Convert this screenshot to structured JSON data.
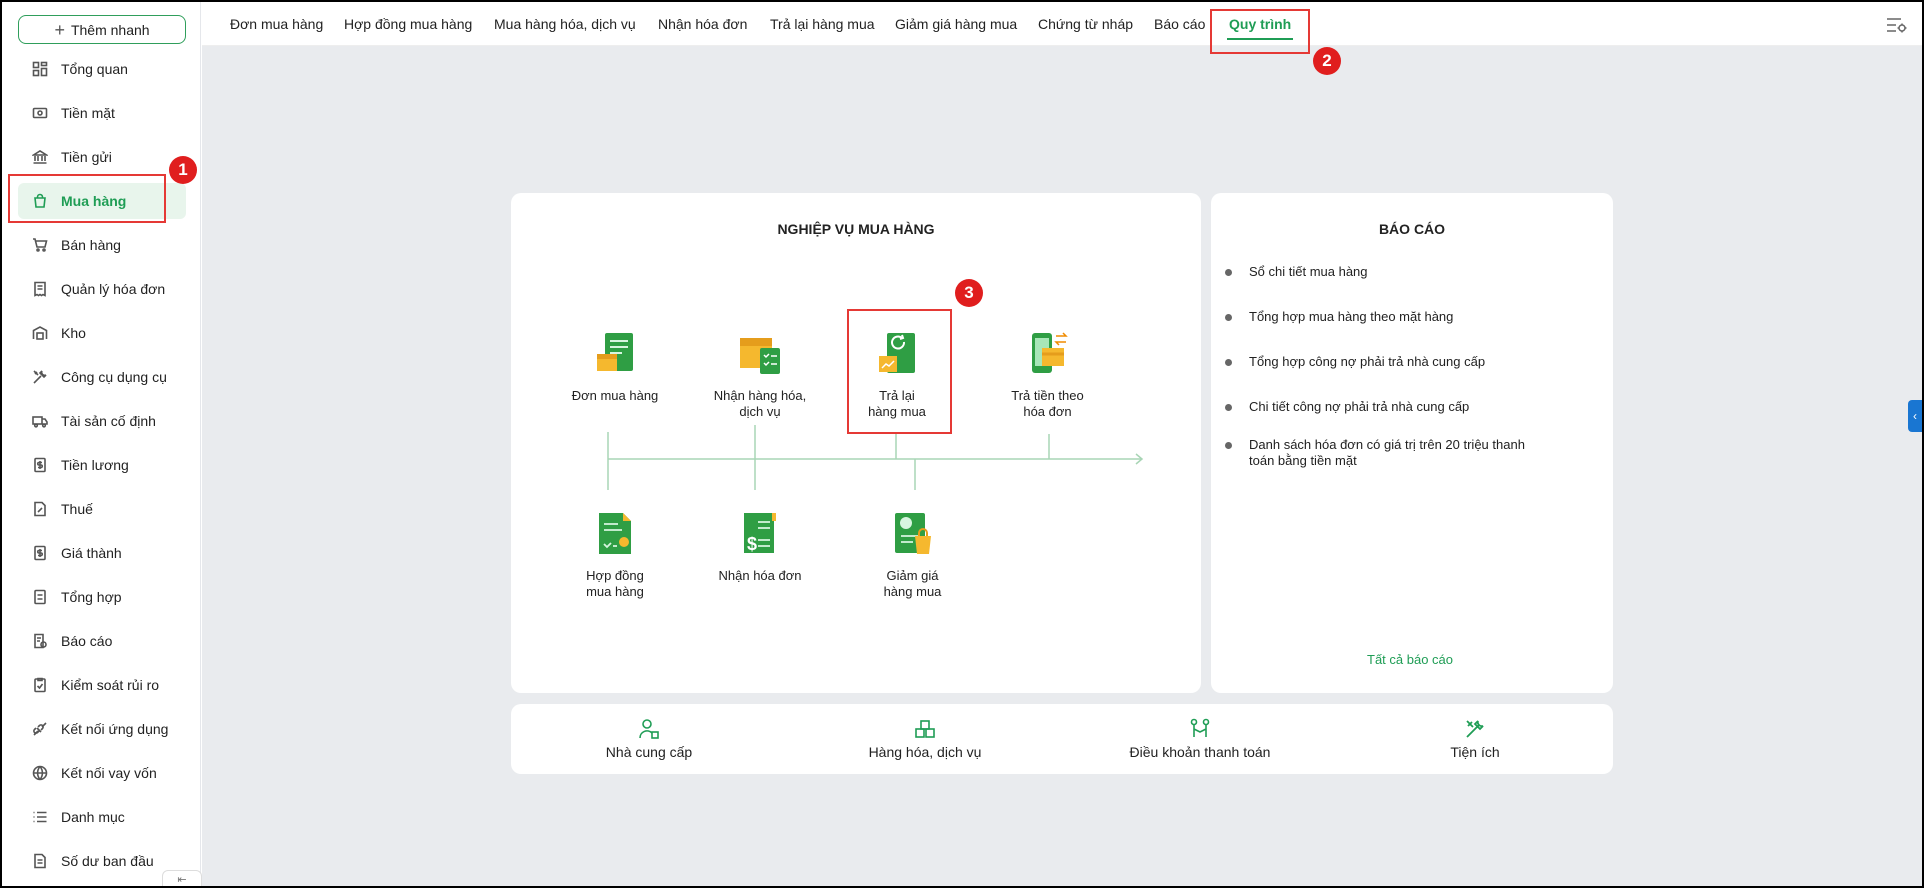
{
  "sidebar": {
    "quick_add": "Thêm nhanh",
    "items": [
      {
        "label": "Tổng quan",
        "icon": "dashboard-icon"
      },
      {
        "label": "Tiền mặt",
        "icon": "cash-icon"
      },
      {
        "label": "Tiền gửi",
        "icon": "bank-icon"
      },
      {
        "label": "Mua hàng",
        "icon": "shopping-bag-icon",
        "active": true
      },
      {
        "label": "Bán hàng",
        "icon": "cart-icon"
      },
      {
        "label": "Quản lý hóa đơn",
        "icon": "invoice-icon"
      },
      {
        "label": "Kho",
        "icon": "warehouse-icon"
      },
      {
        "label": "Công cụ dụng cụ",
        "icon": "tools-icon"
      },
      {
        "label": "Tài sản cố định",
        "icon": "truck-icon"
      },
      {
        "label": "Tiền lương",
        "icon": "salary-icon"
      },
      {
        "label": "Thuế",
        "icon": "tax-icon"
      },
      {
        "label": "Giá thành",
        "icon": "cost-icon"
      },
      {
        "label": "Tổng hợp",
        "icon": "summary-icon"
      },
      {
        "label": "Báo cáo",
        "icon": "report-icon"
      },
      {
        "label": "Kiểm soát rủi ro",
        "icon": "risk-icon"
      },
      {
        "label": "Kết nối ứng dụng",
        "icon": "connect-icon"
      },
      {
        "label": "Kết nối vay vốn",
        "icon": "loan-icon"
      },
      {
        "label": "Danh mục",
        "icon": "list-icon"
      },
      {
        "label": "Số dư ban đầu",
        "icon": "opening-balance-icon"
      }
    ]
  },
  "tabs": [
    {
      "label": "Đơn mua hàng"
    },
    {
      "label": "Hợp đồng mua hàng"
    },
    {
      "label": "Mua hàng hóa, dịch vụ"
    },
    {
      "label": "Nhận hóa đơn"
    },
    {
      "label": "Trả lại hàng mua"
    },
    {
      "label": "Giảm giá hàng mua"
    },
    {
      "label": "Chứng từ nháp"
    },
    {
      "label": "Báo cáo"
    },
    {
      "label": "Quy trình",
      "active": true
    }
  ],
  "process": {
    "title": "NGHIỆP VỤ MUA HÀNG",
    "nodes": {
      "purchase_order": "Đơn mua hàng",
      "receive_goods_1": "Nhận hàng hóa,",
      "receive_goods_2": "dịch vụ",
      "return_1": "Trả lại",
      "return_2": "hàng mua",
      "pay_1": "Trả tiền theo",
      "pay_2": "hóa đơn",
      "contract_1": "Hợp đồng",
      "contract_2": "mua hàng",
      "receive_invoice": "Nhận hóa đơn",
      "discount_1": "Giảm giá",
      "discount_2": "hàng mua"
    }
  },
  "reports": {
    "title": "BÁO CÁO",
    "items": [
      "Sổ chi tiết mua hàng",
      "Tổng hợp mua hàng theo mặt hàng",
      "Tổng hợp công nợ phải trả nhà cung cấp",
      "Chi tiết công nợ phải trả nhà cung cấp",
      "Danh sách hóa đơn có giá trị trên 20 triệu thanh toán bằng tiền mặt"
    ],
    "all_link": "Tất cả báo cáo"
  },
  "bottom": [
    {
      "label": "Nhà cung cấp",
      "icon": "supplier-icon"
    },
    {
      "label": "Hàng hóa, dịch vụ",
      "icon": "goods-icon"
    },
    {
      "label": "Điều khoản thanh toán",
      "icon": "payment-terms-icon"
    },
    {
      "label": "Tiện ích",
      "icon": "utilities-icon"
    }
  ],
  "annotations": [
    "1",
    "2",
    "3"
  ],
  "colors": {
    "accent": "#1f9d55",
    "annotation": "#e53935",
    "background": "#e9ebee"
  }
}
